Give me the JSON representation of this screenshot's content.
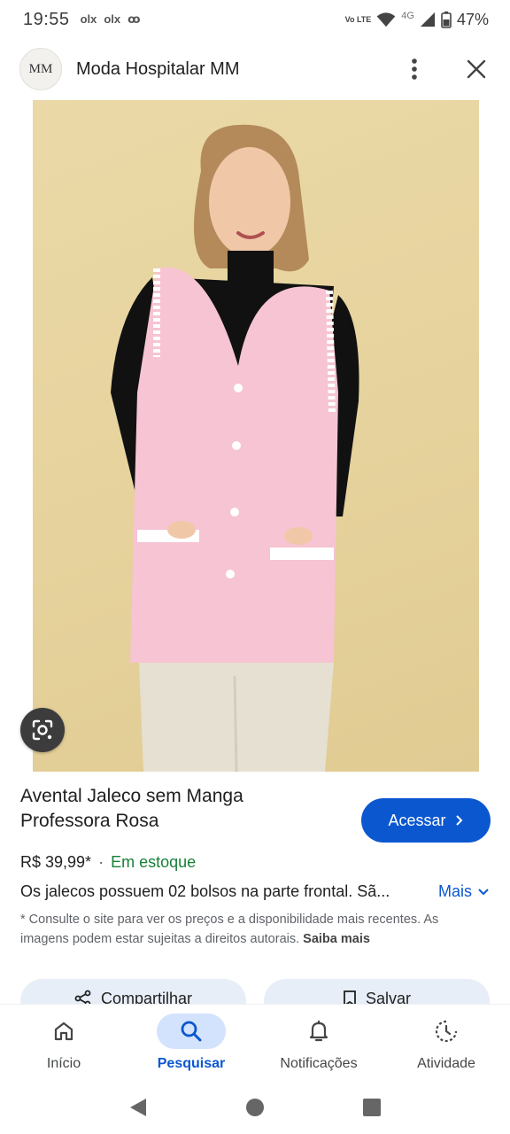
{
  "status_bar": {
    "time": "19:55",
    "apps": [
      "olx",
      "olx",
      "ꝏ"
    ],
    "volte": "Vo LTE",
    "network": "4G",
    "battery": "47%"
  },
  "header": {
    "logo_text": "MM",
    "title": "Moda Hospitalar MM"
  },
  "product": {
    "title": "Avental Jaleco sem Manga Professora Rosa",
    "visit_label": "Acessar",
    "price": "R$ 39,99*",
    "separator": "·",
    "stock": "Em estoque",
    "description": "Os jalecos possuem 02 bolsos na parte frontal. Sã...",
    "more_label": "Mais",
    "disclaimer": "* Consulte o site para ver os preços e a disponibilidade mais recentes. As imagens podem estar sujeitas a direitos autorais.",
    "disclaimer_link": "Saiba mais"
  },
  "actions": {
    "share_label": "Compartilhar",
    "save_label": "Salvar"
  },
  "bottom_nav": [
    {
      "label": "Início",
      "icon": "home-icon",
      "active": false
    },
    {
      "label": "Pesquisar",
      "icon": "search-icon",
      "active": true
    },
    {
      "label": "Notificações",
      "icon": "bell-icon",
      "active": false
    },
    {
      "label": "Atividade",
      "icon": "activity-icon",
      "active": false
    }
  ],
  "colors": {
    "accent": "#0b57d0",
    "stock": "#188038",
    "image_background": "#e6d29c",
    "garment": "#f6c4d2"
  }
}
